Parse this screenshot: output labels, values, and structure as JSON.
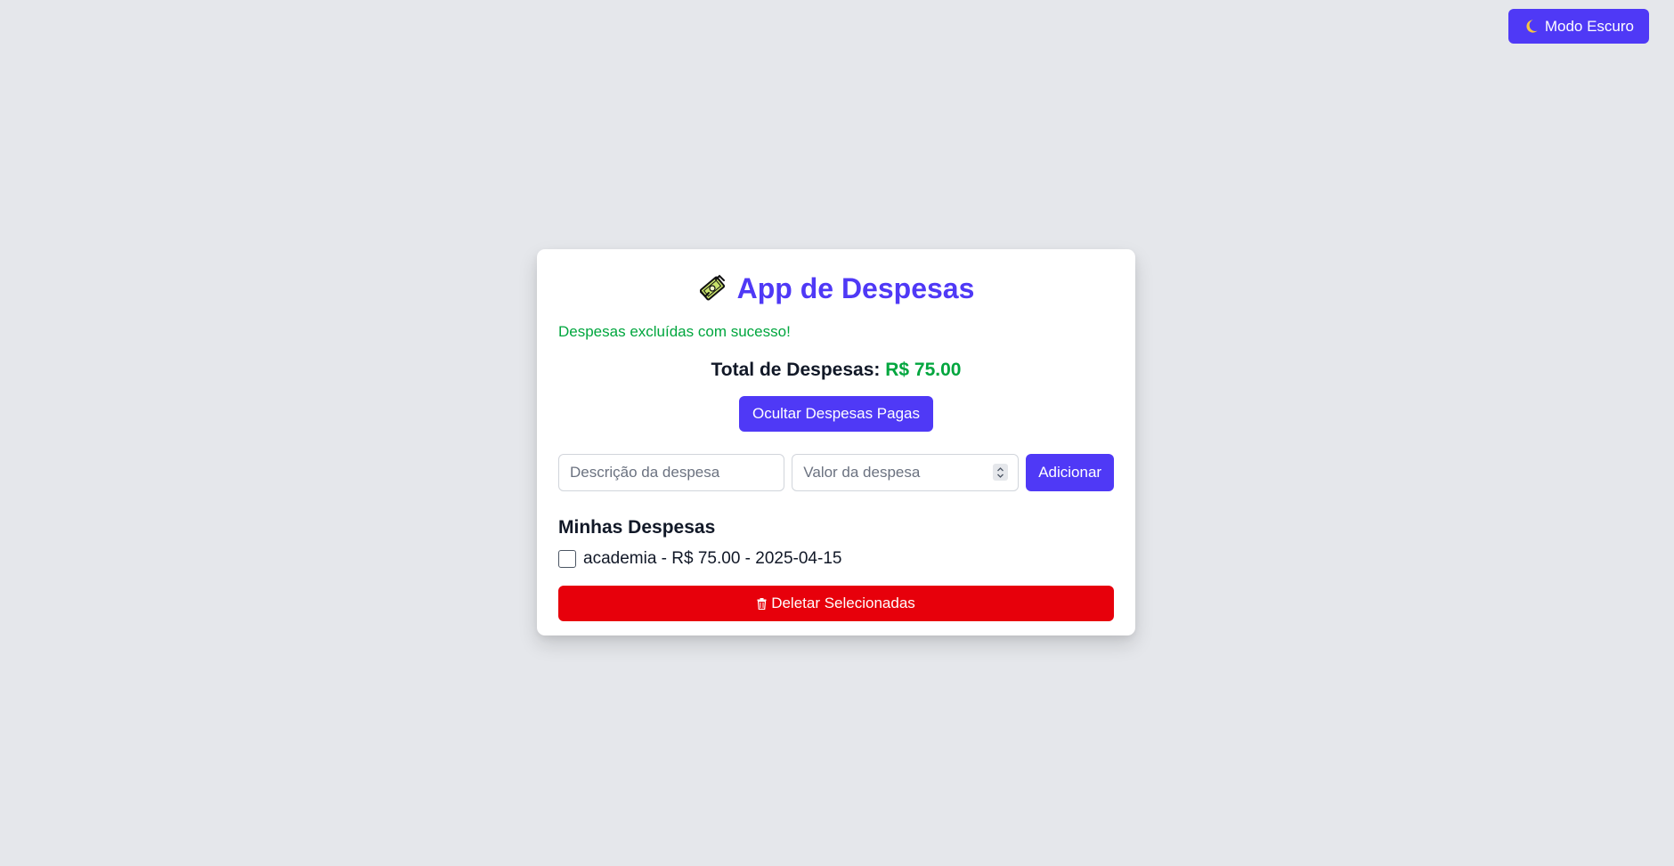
{
  "header": {
    "dark_mode_label": "Modo Escuro",
    "dark_mode_icon": "moon-icon"
  },
  "card": {
    "title": "App de Despesas",
    "title_icon": "money-icon",
    "success_message": "Despesas excluídas com sucesso!",
    "total_label": "Total de Despesas:",
    "total_value": "R$ 75.00",
    "toggle_paid_label": "Ocultar Despesas Pagas",
    "form": {
      "description_placeholder": "Descrição da despesa",
      "value_placeholder": "Valor da despesa",
      "add_label": "Adicionar"
    },
    "list_title": "Minhas Despesas",
    "expenses": [
      {
        "text": "academia - R$ 75.00 - 2025-04-15",
        "checked": false
      }
    ],
    "delete_label": "Deletar Selecionadas",
    "delete_icon": "trash-icon"
  },
  "colors": {
    "background": "#e5e7eb",
    "primary": "#4f39f6",
    "success": "#00a63e",
    "danger": "#e7000b"
  }
}
